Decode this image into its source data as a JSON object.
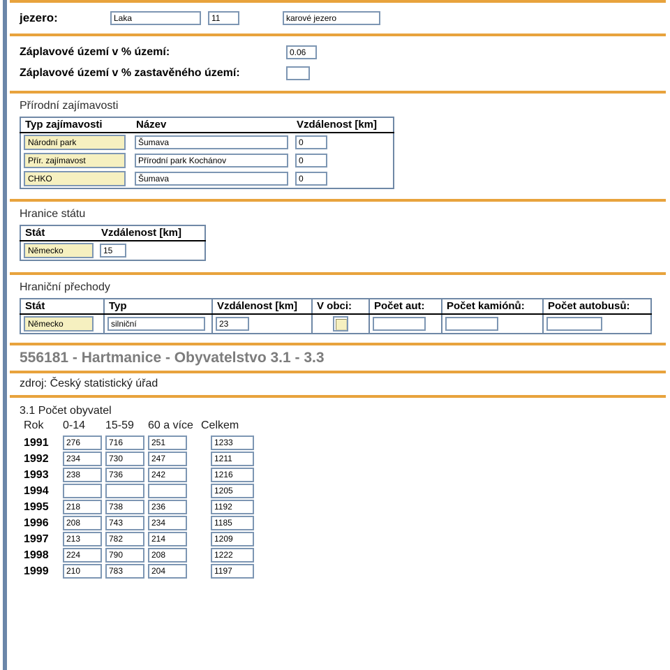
{
  "colors": {
    "rail": "#6b86a9",
    "divider": "#e8a33d",
    "input_border": "#7d96b3",
    "select_bg": "#f6f0c0",
    "title_gray": "#7c7c7c"
  },
  "lake": {
    "label": "jezero:",
    "name": "Laka",
    "number": "11",
    "type": "karové jezero"
  },
  "flood": {
    "label_area": "Záplavové území v % území:",
    "value_area": "0.06",
    "label_built": "Záplavové území v % zastavěného území:",
    "value_built": ""
  },
  "nature": {
    "heading": "Přírodní zajímavosti",
    "columns": [
      "Typ zajímavosti",
      "Název",
      "Vzdálenost [km]"
    ],
    "rows": [
      {
        "type": "Národní park",
        "name": "Šumava",
        "distance": "0"
      },
      {
        "type": "Přír. zajímavost",
        "name": "Přírodní park Kochánov",
        "distance": "0"
      },
      {
        "type": "CHKO",
        "name": "Šumava",
        "distance": "0"
      }
    ]
  },
  "state_border": {
    "heading": "Hranice státu",
    "columns": [
      "Stát",
      "Vzdálenost [km]"
    ],
    "rows": [
      {
        "state": "Německo",
        "distance": "15"
      }
    ]
  },
  "crossings": {
    "heading": "Hraniční přechody",
    "columns": [
      "Stát",
      "Typ",
      "Vzdálenost [km]",
      "V obci:",
      "Počet aut:",
      "Počet kamiónů:",
      "Počet autobusů:"
    ],
    "rows": [
      {
        "state": "Německo",
        "type": "silniční",
        "distance": "23",
        "in_village": "",
        "cars": "",
        "trucks": "",
        "buses": ""
      }
    ]
  },
  "population": {
    "title": "556181 - Hartmanice - Obyvatelstvo 3.1 - 3.3",
    "source": "zdroj: Český statistický úřad",
    "subtitle": "3.1 Počet obyvatel",
    "columns": [
      "Rok",
      "0-14",
      "15-59",
      "60 a více",
      "Celkem"
    ],
    "rows": [
      {
        "year": "1991",
        "a": "276",
        "b": "716",
        "c": "251",
        "total": "1233"
      },
      {
        "year": "1992",
        "a": "234",
        "b": "730",
        "c": "247",
        "total": "1211"
      },
      {
        "year": "1993",
        "a": "238",
        "b": "736",
        "c": "242",
        "total": "1216"
      },
      {
        "year": "1994",
        "a": "",
        "b": "",
        "c": "",
        "total": "1205"
      },
      {
        "year": "1995",
        "a": "218",
        "b": "738",
        "c": "236",
        "total": "1192"
      },
      {
        "year": "1996",
        "a": "208",
        "b": "743",
        "c": "234",
        "total": "1185"
      },
      {
        "year": "1997",
        "a": "213",
        "b": "782",
        "c": "214",
        "total": "1209"
      },
      {
        "year": "1998",
        "a": "224",
        "b": "790",
        "c": "208",
        "total": "1222"
      },
      {
        "year": "1999",
        "a": "210",
        "b": "783",
        "c": "204",
        "total": "1197"
      }
    ]
  }
}
